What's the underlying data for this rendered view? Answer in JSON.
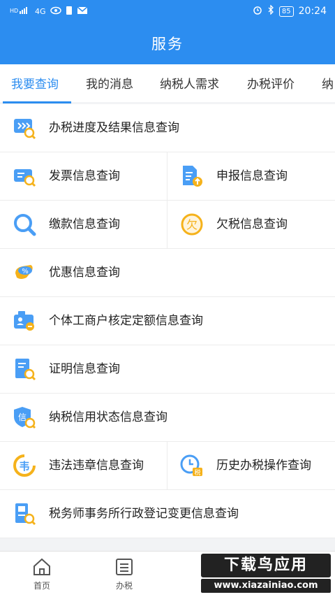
{
  "status_bar": {
    "network": "4G",
    "battery": "85",
    "time": "20:24"
  },
  "header": {
    "title": "服务"
  },
  "tabs": [
    {
      "label": "我要查询",
      "active": true
    },
    {
      "label": "我的消息",
      "active": false
    },
    {
      "label": "纳税人需求",
      "active": false
    },
    {
      "label": "办税评价",
      "active": false
    },
    {
      "label": "纳",
      "active": false
    }
  ],
  "items": [
    {
      "label": "办税进度及结果信息查询",
      "icon": "progress-search-icon"
    },
    {
      "label": "发票信息查询",
      "icon": "invoice-search-icon"
    },
    {
      "label": "申报信息查询",
      "icon": "declaration-upload-icon"
    },
    {
      "label": "缴款信息查询",
      "icon": "magnifier-icon"
    },
    {
      "label": "欠税信息查询",
      "icon": "owed-tax-icon"
    },
    {
      "label": "优惠信息查询",
      "icon": "discount-icon"
    },
    {
      "label": "个体工商户核定定额信息查询",
      "icon": "business-id-icon"
    },
    {
      "label": "证明信息查询",
      "icon": "certificate-search-icon"
    },
    {
      "label": "纳税信用状态信息查询",
      "icon": "credit-shield-icon"
    },
    {
      "label": "违法违章信息查询",
      "icon": "violation-icon"
    },
    {
      "label": "历史办税操作查询",
      "icon": "history-clock-icon"
    },
    {
      "label": "税务师事务所行政登记变更信息查询",
      "icon": "tax-agency-icon"
    }
  ],
  "bottom_nav": [
    {
      "label": "首页",
      "icon": "home-icon"
    },
    {
      "label": "办税",
      "icon": "list-icon"
    }
  ],
  "watermark": {
    "title": "下载鸟应用",
    "url": "www.xiazainiao.com"
  },
  "colors": {
    "accent": "#2c8df0",
    "icon_yellow": "#f5b21b"
  }
}
